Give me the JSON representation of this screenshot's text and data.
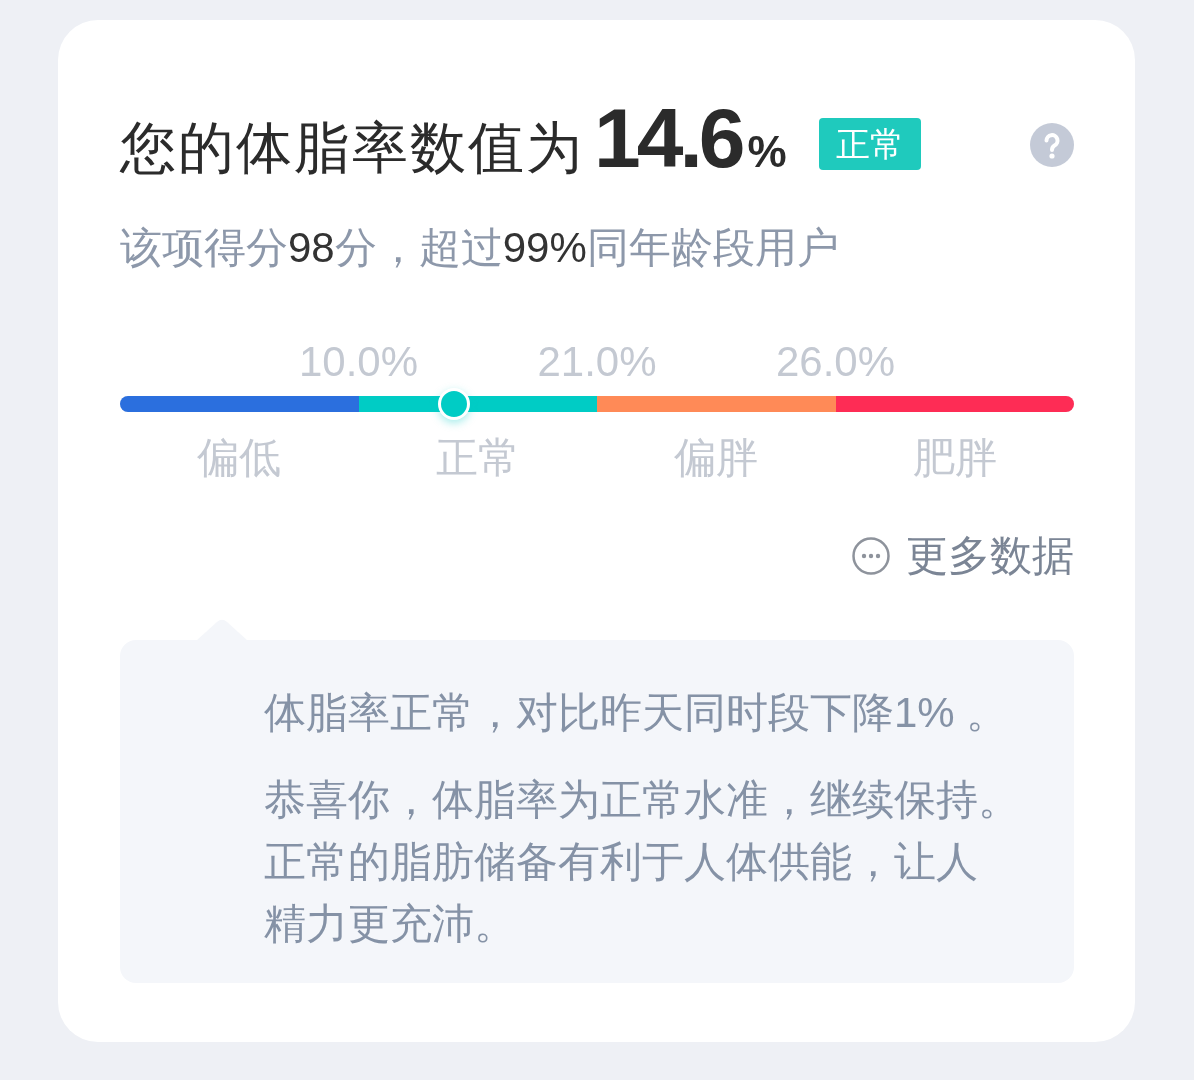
{
  "header": {
    "title": "您的体脂率数值为",
    "value": "14.6",
    "unit": "%",
    "badge": "正常"
  },
  "summary": "该项得分**98**分，超过**99%**同年龄段用户",
  "scale": {
    "ticks": [
      "10.0%",
      "21.0%",
      "26.0%"
    ],
    "segments": [
      {
        "label": "偏低",
        "color": "#2b6fde"
      },
      {
        "label": "正常",
        "color": "#00ccc5"
      },
      {
        "label": "偏胖",
        "color": "#ff8a57"
      },
      {
        "label": "肥胖",
        "color": "#fe2c55"
      }
    ],
    "level": 0.35
  },
  "more_link": "更多数据",
  "advice": {
    "paragraphs": [
      {
        "lines": [
          "体脂率正常，对比昨天同时段下降1% 。"
        ]
      },
      {
        "lines": [
          "恭喜你，体脂率为正常水准，继续保持。",
          "正常的脂肪储备有利于人体供能，让人",
          "精力更充沛。"
        ]
      }
    ]
  }
}
